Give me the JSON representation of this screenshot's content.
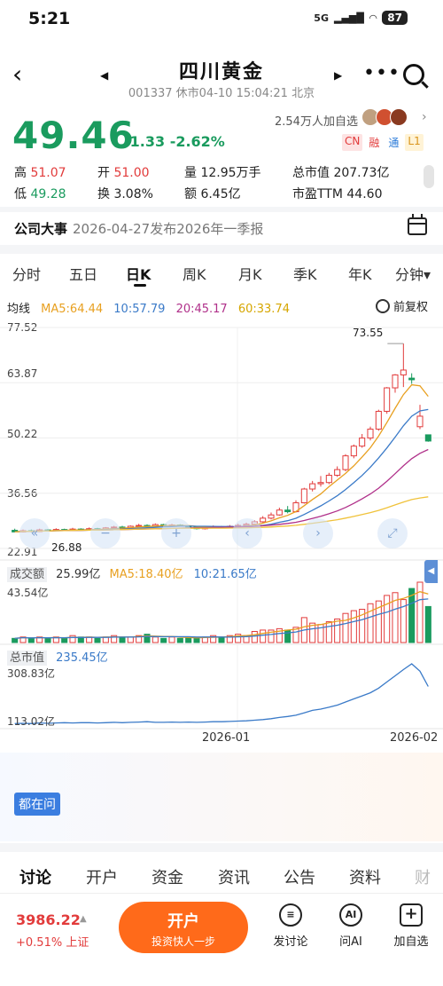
{
  "status_bar": {
    "time": "5:21",
    "network": "5G",
    "battery": "87"
  },
  "header": {
    "stock_name": "四川黄金",
    "subtitle": "001337 休市04-10 15:04:21 北京"
  },
  "quote": {
    "price": "49.46",
    "change": "-1.33 -2.62%",
    "followers": "2.54万人加自选",
    "tags": [
      "CN",
      "融",
      "通",
      "L1"
    ],
    "stats": {
      "high_label": "高",
      "high": "51.07",
      "open_label": "开",
      "open": "51.00",
      "volume_label": "量",
      "volume": "12.95万手",
      "mcap_label": "总市值",
      "mcap": "207.73亿",
      "low_label": "低",
      "low": "49.28",
      "turnover_label": "换",
      "turnover": "3.08%",
      "amount_label": "额",
      "amount": "6.45亿",
      "pe_label": "市盈TTM",
      "pe": "44.60"
    }
  },
  "event": {
    "label": "公司大事",
    "text": "2026-04-27发布2026年一季报"
  },
  "periods": [
    "分时",
    "五日",
    "日K",
    "周K",
    "月K",
    "季K",
    "年K",
    "分钟▾"
  ],
  "ma_legend": {
    "label": "均线",
    "ma5": "MA5:64.44",
    "ma10": "10:57.79",
    "ma20": "20:45.17",
    "ma60": "60:33.74",
    "adjust": "前复权"
  },
  "colors": {
    "up": "#e23b3b",
    "down": "#1a9b5e",
    "ma5": "#e8a020",
    "ma10": "#3a7ac8",
    "ma20": "#b0308a",
    "ma60": "#f0c23a",
    "mcap_line": "#3a7ac8"
  },
  "price_axis": [
    "77.52",
    "63.87",
    "50.22",
    "36.56",
    "22.91"
  ],
  "annotations": {
    "max": "73.55",
    "min": "26.88"
  },
  "volume_panel": {
    "label": "成交额",
    "value": "25.99亿",
    "ma5": "MA5:18.40亿",
    "ma10": "10:21.65亿",
    "top": "43.54亿"
  },
  "mcap_panel": {
    "label": "总市值",
    "value": "235.45亿",
    "top": "308.83亿",
    "bottom": "113.02亿"
  },
  "dates": [
    "2026-01",
    "2026-02"
  ],
  "ask": {
    "label": "都在问"
  },
  "bottom_tabs": [
    "讨论",
    "开户",
    "资金",
    "资讯",
    "公告",
    "资料",
    "财务"
  ],
  "footer": {
    "index_value": "3986.22",
    "index_change": "+0.51% 上证",
    "open_main": "开户",
    "open_sub": "投资快人一步",
    "post": "发讨论",
    "ask_ai": "问AI",
    "add_fav": "加自选"
  },
  "chart_data": {
    "type": "candlestick",
    "ylim": [
      22.91,
      77.52
    ],
    "candles": [
      {
        "o": 27.4,
        "c": 27.0,
        "h": 27.8,
        "l": 26.88
      },
      {
        "o": 27.0,
        "c": 27.3,
        "h": 27.6,
        "l": 26.9
      },
      {
        "o": 27.3,
        "c": 27.1,
        "h": 27.6,
        "l": 26.9
      },
      {
        "o": 27.1,
        "c": 27.5,
        "h": 27.8,
        "l": 27.0
      },
      {
        "o": 27.5,
        "c": 27.3,
        "h": 27.7,
        "l": 27.1
      },
      {
        "o": 27.3,
        "c": 27.6,
        "h": 27.9,
        "l": 27.2
      },
      {
        "o": 27.6,
        "c": 27.4,
        "h": 27.8,
        "l": 27.2
      },
      {
        "o": 27.4,
        "c": 27.7,
        "h": 28.0,
        "l": 27.3
      },
      {
        "o": 27.7,
        "c": 27.5,
        "h": 27.9,
        "l": 27.3
      },
      {
        "o": 27.5,
        "c": 27.8,
        "h": 28.1,
        "l": 27.4
      },
      {
        "o": 27.8,
        "c": 27.6,
        "h": 28.0,
        "l": 27.4
      },
      {
        "o": 27.6,
        "c": 28.0,
        "h": 28.2,
        "l": 27.5
      },
      {
        "o": 28.0,
        "c": 28.2,
        "h": 28.5,
        "l": 27.8
      },
      {
        "o": 28.2,
        "c": 28.0,
        "h": 28.5,
        "l": 27.8
      },
      {
        "o": 28.0,
        "c": 28.4,
        "h": 28.6,
        "l": 27.9
      },
      {
        "o": 28.4,
        "c": 28.6,
        "h": 29.0,
        "l": 28.2
      },
      {
        "o": 28.6,
        "c": 28.4,
        "h": 28.9,
        "l": 28.2
      },
      {
        "o": 28.4,
        "c": 28.8,
        "h": 29.1,
        "l": 28.3
      },
      {
        "o": 28.8,
        "c": 28.5,
        "h": 29.0,
        "l": 28.3
      },
      {
        "o": 28.5,
        "c": 28.7,
        "h": 29.0,
        "l": 28.3
      },
      {
        "o": 28.7,
        "c": 28.5,
        "h": 28.9,
        "l": 28.3
      },
      {
        "o": 28.5,
        "c": 28.2,
        "h": 28.7,
        "l": 28.0
      },
      {
        "o": 28.2,
        "c": 27.8,
        "h": 28.4,
        "l": 27.6
      },
      {
        "o": 27.8,
        "c": 28.0,
        "h": 28.3,
        "l": 27.6
      },
      {
        "o": 28.0,
        "c": 28.3,
        "h": 28.6,
        "l": 27.9
      },
      {
        "o": 28.3,
        "c": 28.1,
        "h": 28.5,
        "l": 27.9
      },
      {
        "o": 28.1,
        "c": 28.4,
        "h": 28.7,
        "l": 28.0
      },
      {
        "o": 28.4,
        "c": 28.6,
        "h": 29.0,
        "l": 28.2
      },
      {
        "o": 28.6,
        "c": 28.9,
        "h": 29.3,
        "l": 28.4
      },
      {
        "o": 28.9,
        "c": 29.5,
        "h": 29.9,
        "l": 28.7
      },
      {
        "o": 29.5,
        "c": 30.4,
        "h": 30.9,
        "l": 29.3
      },
      {
        "o": 30.4,
        "c": 31.2,
        "h": 31.8,
        "l": 30.1
      },
      {
        "o": 31.2,
        "c": 32.4,
        "h": 33.0,
        "l": 31.0
      },
      {
        "o": 32.4,
        "c": 32.0,
        "h": 33.4,
        "l": 31.6
      },
      {
        "o": 32.0,
        "c": 34.2,
        "h": 34.8,
        "l": 31.8
      },
      {
        "o": 34.2,
        "c": 37.6,
        "h": 37.9,
        "l": 34.0
      },
      {
        "o": 37.6,
        "c": 38.9,
        "h": 39.6,
        "l": 37.0
      },
      {
        "o": 38.9,
        "c": 39.2,
        "h": 40.8,
        "l": 38.2
      },
      {
        "o": 39.2,
        "c": 41.0,
        "h": 41.6,
        "l": 38.8
      },
      {
        "o": 41.0,
        "c": 42.4,
        "h": 43.2,
        "l": 40.6
      },
      {
        "o": 42.4,
        "c": 45.8,
        "h": 46.2,
        "l": 42.0
      },
      {
        "o": 45.8,
        "c": 48.2,
        "h": 48.6,
        "l": 45.2
      },
      {
        "o": 48.2,
        "c": 50.2,
        "h": 51.2,
        "l": 47.8
      },
      {
        "o": 50.2,
        "c": 52.4,
        "h": 53.0,
        "l": 49.6
      },
      {
        "o": 52.4,
        "c": 56.8,
        "h": 57.2,
        "l": 52.0
      },
      {
        "o": 56.8,
        "c": 62.6,
        "h": 62.8,
        "l": 56.2
      },
      {
        "o": 62.6,
        "c": 65.8,
        "h": 66.0,
        "l": 61.4
      },
      {
        "o": 65.8,
        "c": 67.0,
        "h": 73.55,
        "l": 62.8
      },
      {
        "o": 65.0,
        "c": 64.6,
        "h": 66.2,
        "l": 63.6
      },
      {
        "o": 53.0,
        "c": 55.6,
        "h": 58.4,
        "l": 52.4
      },
      {
        "o": 51.0,
        "c": 49.46,
        "h": 51.07,
        "l": 49.28
      }
    ],
    "volume": [
      3,
      4,
      3,
      4,
      3,
      4,
      3,
      5,
      4,
      4,
      3,
      4,
      5,
      4,
      4,
      5,
      6,
      4,
      3,
      4,
      3,
      4,
      3,
      4,
      5,
      4,
      5,
      6,
      5,
      8,
      9,
      9,
      10,
      9,
      11,
      18,
      14,
      13,
      15,
      17,
      21,
      23,
      24,
      28,
      30,
      34,
      36,
      31,
      39,
      43.54,
      25.99
    ],
    "mcap": [
      115,
      116,
      115,
      117,
      116,
      117,
      118,
      117,
      118,
      118,
      117,
      118,
      119,
      118,
      119,
      120,
      121,
      119,
      119,
      120,
      119,
      120,
      119,
      120,
      121,
      121,
      122,
      123,
      124,
      126,
      128,
      131,
      135,
      138,
      142,
      150,
      158,
      162,
      168,
      175,
      185,
      195,
      205,
      215,
      230,
      250,
      270,
      290,
      308.83,
      285,
      235.45
    ]
  }
}
